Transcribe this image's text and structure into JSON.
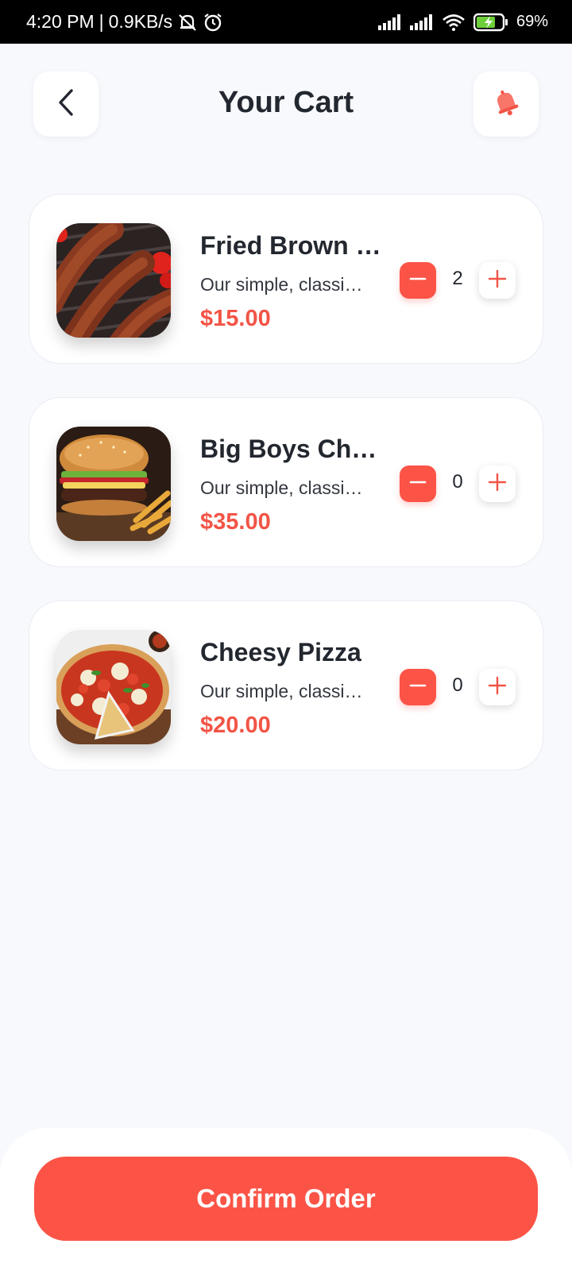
{
  "status_bar": {
    "time": "4:20 PM",
    "network_speed": "0.9KB/s",
    "battery": "69%",
    "icons": [
      "notifications-off-icon",
      "alarm-icon",
      "signal-icon",
      "signal-icon",
      "wifi-icon",
      "battery-charging-icon"
    ]
  },
  "header": {
    "title": "Your Cart",
    "back_icon": "chevron-left-icon",
    "bell_icon": "bell-icon"
  },
  "cart": {
    "items": [
      {
        "name": "Fried Brown Sausages",
        "description": "Our simple, classic sausages",
        "price": "$15.00",
        "quantity": "2",
        "image": "sausages-image"
      },
      {
        "name": "Big Boys Cheeseburger",
        "description": "Our simple, classic burger",
        "price": "$35.00",
        "quantity": "0",
        "image": "burger-image"
      },
      {
        "name": "Cheesy Pizza",
        "description": "Our simple, classic pizza",
        "price": "$20.00",
        "quantity": "0",
        "image": "pizza-image"
      }
    ]
  },
  "footer": {
    "confirm_label": "Confirm Order"
  },
  "colors": {
    "accent": "#fb5447",
    "price": "#f25446",
    "background": "#f8f9fd",
    "text": "#23272f"
  }
}
